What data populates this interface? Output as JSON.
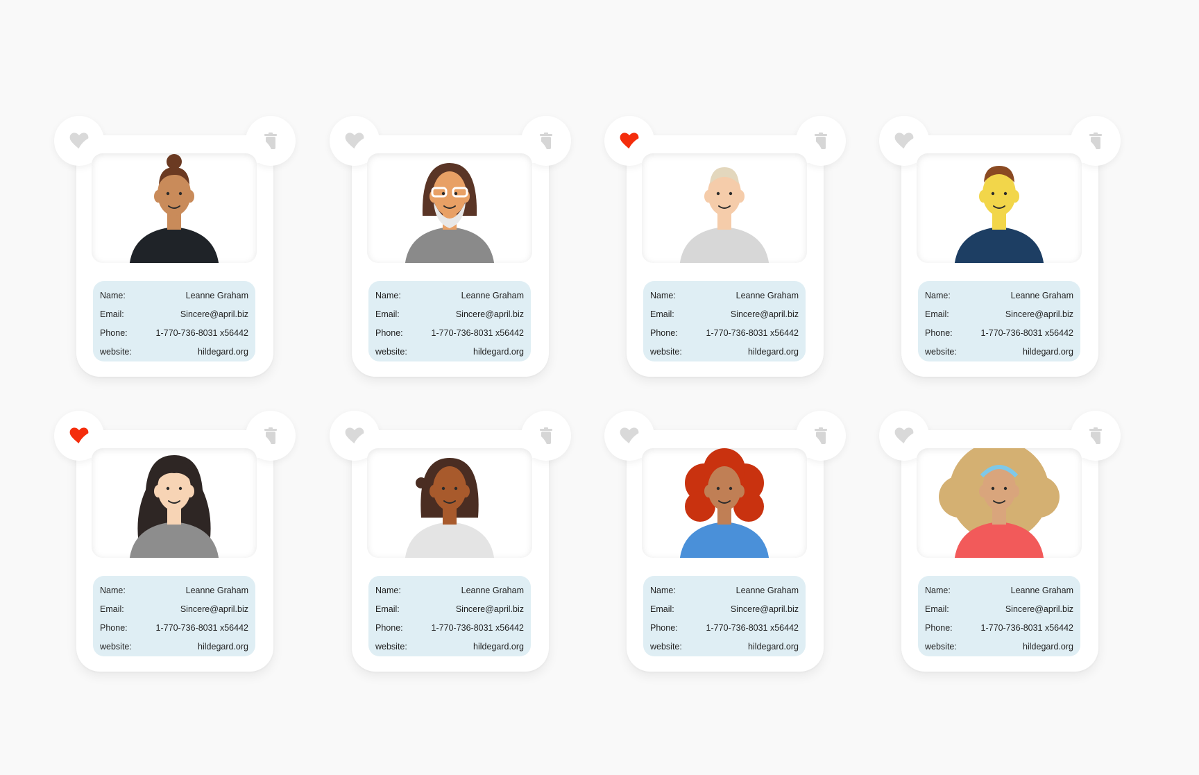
{
  "labels": {
    "name": "Name:",
    "email": "Email:",
    "phone": "Phone:",
    "website": "website:"
  },
  "colors": {
    "favorite_active": "#f42d0c",
    "icon_inactive": "#d9d9d9",
    "info_background": "#dfeef4",
    "page_background": "#f9f9f9"
  },
  "icons": {
    "favorite": "heart-icon",
    "delete": "trash-icon"
  },
  "cards": [
    {
      "name": "Leanne Graham",
      "email": "Sincere@april.biz",
      "phone": "1-770-736-8031 x56442",
      "website": "hildegard.org",
      "favorite": false,
      "hair": "#6b3a22",
      "skin": "#c98b5a",
      "shirt": "#1f2328",
      "style": "bun"
    },
    {
      "name": "Leanne Graham",
      "email": "Sincere@april.biz",
      "phone": "1-770-736-8031 x56442",
      "website": "hildegard.org",
      "favorite": false,
      "hair": "#5a3526",
      "skin": "#e8a065",
      "shirt": "#8a8a8a",
      "style": "beard"
    },
    {
      "name": "Leanne Graham",
      "email": "Sincere@april.biz",
      "phone": "1-770-736-8031 x56442",
      "website": "hildegard.org",
      "favorite": true,
      "hair": "#e3d7bd",
      "skin": "#f5ccaa",
      "shirt": "#d7d7d7",
      "style": "bald"
    },
    {
      "name": "Leanne Graham",
      "email": "Sincere@april.biz",
      "phone": "1-770-736-8031 x56442",
      "website": "hildegard.org",
      "favorite": false,
      "hair": "#8a4a22",
      "skin": "#f2d64a",
      "shirt": "#1d3e63",
      "style": "short"
    },
    {
      "name": "Leanne Graham",
      "email": "Sincere@april.biz",
      "phone": "1-770-736-8031 x56442",
      "website": "hildegard.org",
      "favorite": true,
      "hair": "#2e2624",
      "skin": "#f7d4b5",
      "shirt": "#8d8d8d",
      "style": "long"
    },
    {
      "name": "Leanne Graham",
      "email": "Sincere@april.biz",
      "phone": "1-770-736-8031 x56442",
      "website": "hildegard.org",
      "favorite": false,
      "hair": "#4a2d22",
      "skin": "#a85a2c",
      "shirt": "#e4e4e4",
      "style": "bob"
    },
    {
      "name": "Leanne Graham",
      "email": "Sincere@april.biz",
      "phone": "1-770-736-8031 x56442",
      "website": "hildegard.org",
      "favorite": false,
      "hair": "#c9320f",
      "skin": "#c07f55",
      "shirt": "#4a90d9",
      "style": "curly"
    },
    {
      "name": "Leanne Graham",
      "email": "Sincere@april.biz",
      "phone": "1-770-736-8031 x56442",
      "website": "hildegard.org",
      "favorite": false,
      "hair": "#d4b072",
      "skin": "#d9a57c",
      "shirt": "#f25a5a",
      "style": "afro"
    }
  ]
}
